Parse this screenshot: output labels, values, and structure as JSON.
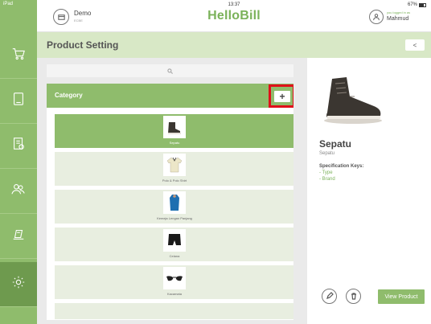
{
  "status": {
    "carrier": "iPad",
    "time": "13:37",
    "battery": "67%"
  },
  "header": {
    "store_name": "Demo",
    "store_sub": "ECBE",
    "logo": "HelloBill",
    "login_label": "you logged in as",
    "user_name": "Mahmud"
  },
  "sidebar": {
    "items": [
      {
        "icon": "cart-icon"
      },
      {
        "icon": "tablet-icon"
      },
      {
        "icon": "receipt-icon"
      },
      {
        "icon": "customers-icon"
      },
      {
        "icon": "report-icon"
      },
      {
        "icon": "settings-icon",
        "active": true
      }
    ]
  },
  "page": {
    "title": "Product Setting",
    "back_label": "<"
  },
  "search": {
    "placeholder": ""
  },
  "category": {
    "title": "Category",
    "add_label": "+",
    "items": [
      {
        "label": "Sepatu",
        "icon": "shoe-icon",
        "selected": true
      },
      {
        "label": "Polo & Polo Shirt",
        "icon": "polo-shirt-icon",
        "selected": false
      },
      {
        "label": "Kemeja Lengan Panjang",
        "icon": "long-sleeve-shirt-icon",
        "selected": false
      },
      {
        "label": "Celana",
        "icon": "shorts-icon",
        "selected": false
      },
      {
        "label": "Kacamata",
        "icon": "sunglasses-icon",
        "selected": false
      }
    ]
  },
  "product": {
    "name": "Sepatu",
    "category": "Sepatu",
    "spec_title": "Specification Keys:",
    "spec_keys": [
      "- Type",
      "- Brand"
    ],
    "view_label": "View Product"
  },
  "colors": {
    "accent": "#8fbc6c",
    "accent_dark": "#6e9a4e",
    "title_bar": "#d8e8c6",
    "highlight": "#e0101a"
  }
}
